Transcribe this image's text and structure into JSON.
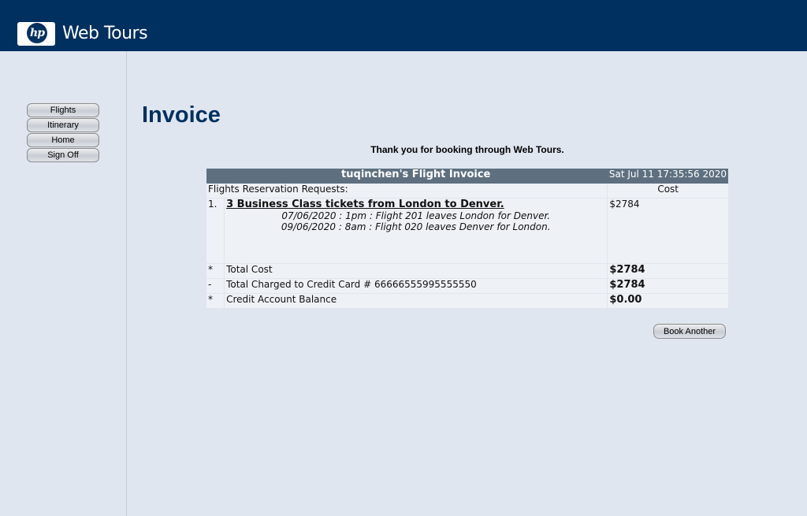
{
  "header": {
    "logo_letters": "hp",
    "app_title": "Web Tours"
  },
  "nav": [
    {
      "label": "Flights"
    },
    {
      "label": "Itinerary"
    },
    {
      "label": "Home"
    },
    {
      "label": "Sign Off"
    }
  ],
  "page_title": "Invoice",
  "thanks_message": "Thank you for booking through Web Tours.",
  "invoice": {
    "title": "tuqinchen's Flight Invoice",
    "date": "Sat Jul 11 17:35:56 2020",
    "requests_label": "Flights Reservation Requests:",
    "cost_label": "Cost",
    "item": {
      "number": "1.",
      "title": "3 Business Class tickets from London to Denver.",
      "leg1": "07/06/2020 : 1pm : Flight 201 leaves London for Denver.",
      "leg2": "09/06/2020 : 8am : Flight 020 leaves Denver for London.",
      "cost": "$2784"
    },
    "summary": [
      {
        "marker": "*",
        "label": "Total Cost",
        "value": "$2784"
      },
      {
        "marker": "-",
        "label": "Total Charged to Credit Card # 66666555995555550",
        "value": "$2784"
      },
      {
        "marker": "*",
        "label": "Credit Account Balance",
        "value": "$0.00"
      }
    ]
  },
  "book_another_label": "Book Another",
  "colors": {
    "header_bg": "#00305f",
    "page_bg": "#e0e6f0",
    "table_head_bg": "#5e7080",
    "title_color": "#00305f"
  }
}
